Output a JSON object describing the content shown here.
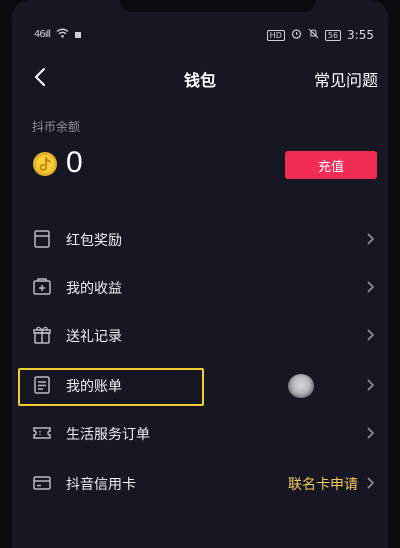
{
  "status_bar": {
    "signal": "46ıll",
    "time": "3:55",
    "battery": "56",
    "hd_badge": "HD"
  },
  "nav": {
    "title": "钱包",
    "faq_label": "常见问题"
  },
  "balance": {
    "label": "抖币余额",
    "value": "0",
    "recharge_label": "充值"
  },
  "menu": [
    {
      "label": "红包奖励",
      "icon": "red-packet-icon"
    },
    {
      "label": "我的收益",
      "icon": "earnings-icon"
    },
    {
      "label": "送礼记录",
      "icon": "gift-icon"
    },
    {
      "label": "我的账单",
      "icon": "bill-icon"
    },
    {
      "label": "生活服务订单",
      "icon": "ticket-icon"
    },
    {
      "label": "抖音信用卡",
      "icon": "credit-card-icon",
      "extra": "联名卡申请"
    }
  ],
  "colors": {
    "background": "#161722",
    "accent": "#f12d55",
    "highlight": "#f2d033",
    "extra_text": "#f4c95b"
  }
}
